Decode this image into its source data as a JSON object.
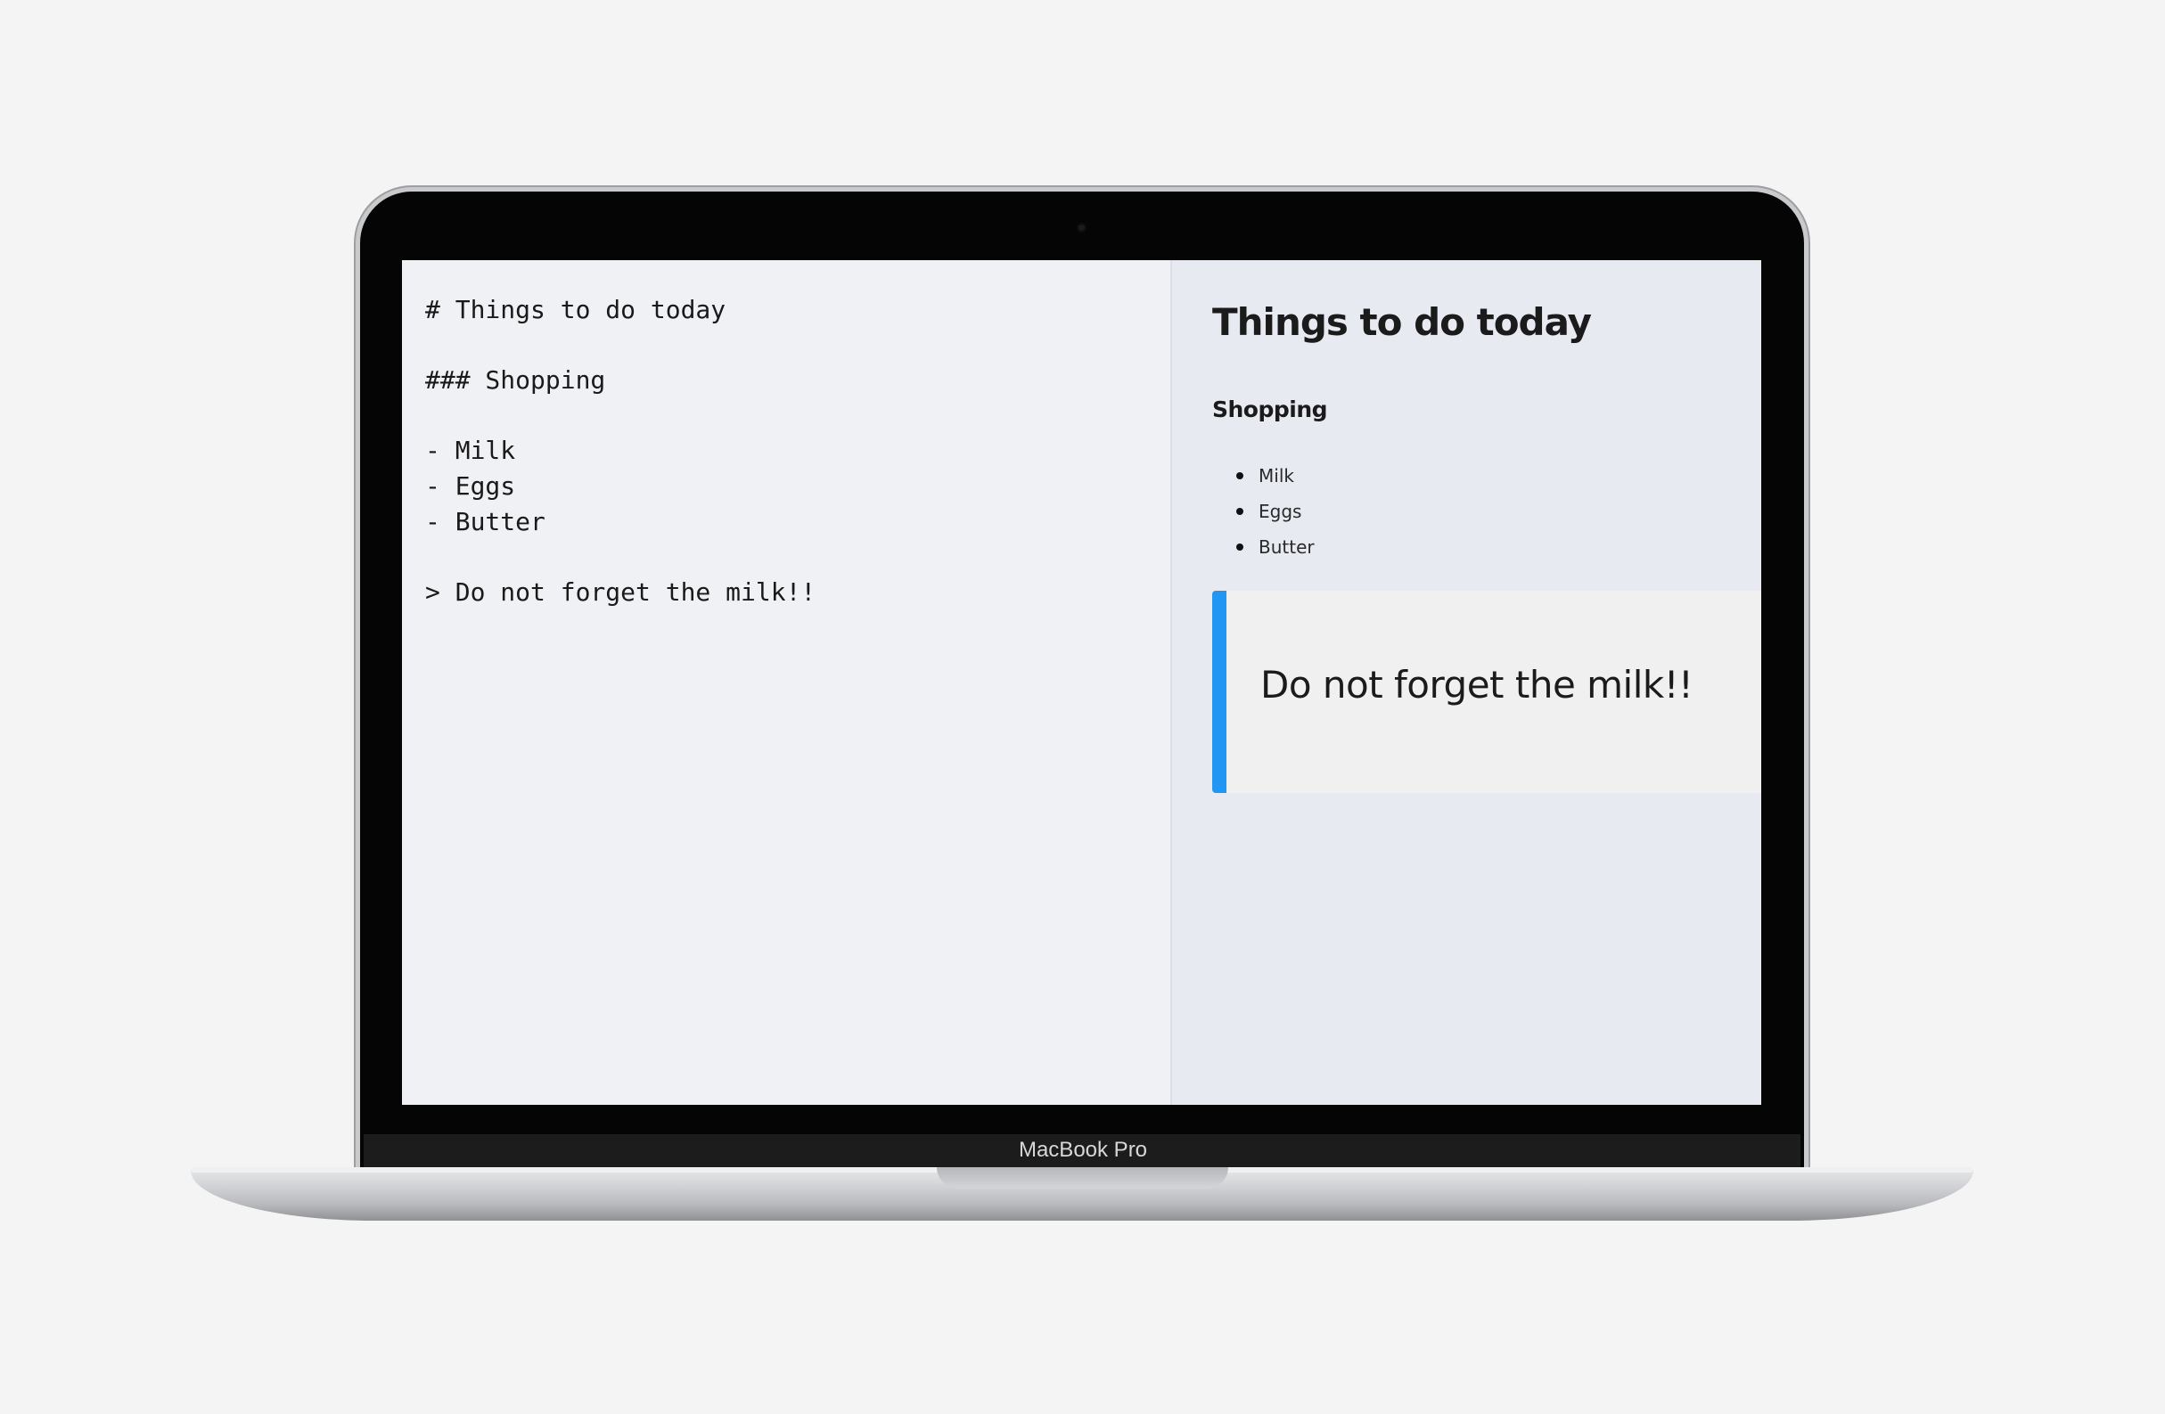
{
  "device": {
    "brand_label": "MacBook Pro"
  },
  "editor": {
    "lines": [
      "# Things to do today",
      "",
      "### Shopping",
      "",
      "- Milk",
      "- Eggs",
      "- Butter",
      "",
      "> Do not forget the milk!!"
    ]
  },
  "preview": {
    "heading": "Things to do today",
    "subheading": "Shopping",
    "items": [
      "Milk",
      "Eggs",
      "Butter"
    ],
    "blockquote": "Do not forget the milk!!",
    "accent_color": "#2196f3"
  }
}
